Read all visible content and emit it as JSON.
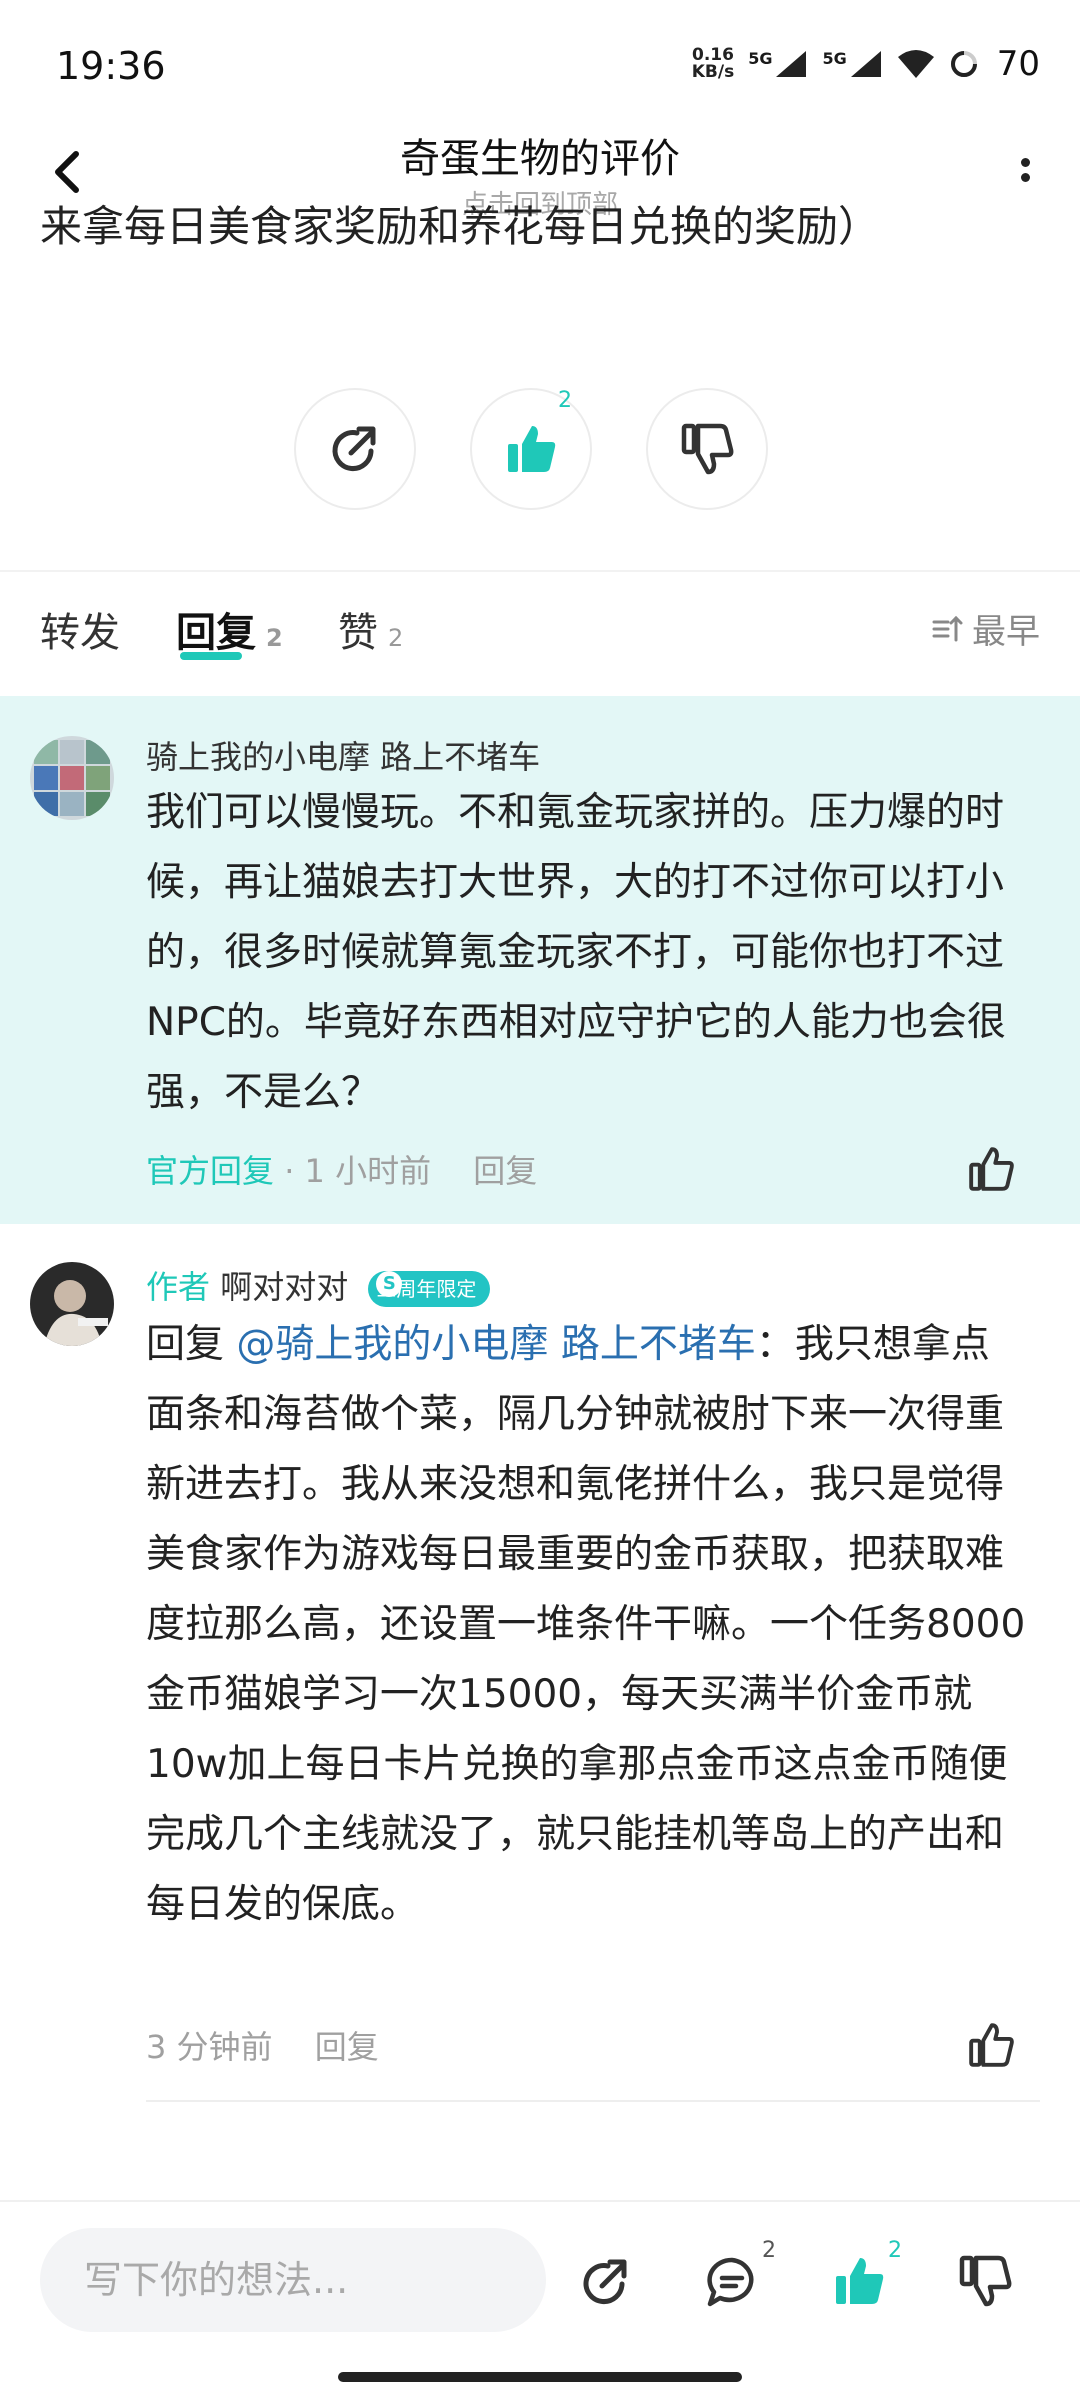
{
  "status_bar": {
    "time": "19:36",
    "net_speed_value": "0.16",
    "net_speed_unit": "KB/s",
    "signal1_label": "5G",
    "signal2_label": "5G",
    "battery": "70"
  },
  "header": {
    "title": "奇蛋生物的评价",
    "subtitle": "点击回到顶部"
  },
  "partial_text": "来拿每日美食家奖励和养花每日兑换的奖励）",
  "actions": {
    "like_count": "2"
  },
  "tabs": {
    "repost": "转发",
    "reply": "回复",
    "reply_count": "2",
    "like": "赞",
    "like_count": "2",
    "sort": "最早"
  },
  "comments": [
    {
      "username": "骑上我的小电摩 路上不堵车",
      "body": "我们可以慢慢玩。不和氪金玩家拼的。压力爆的时候，再让猫娘去打大世界，大的打不过你可以打小的，很多时候就算氪金玩家不打，可能你也打不过NPC的。毕竟好东西相对应守护它的人能力也会很强，不是么？",
      "official_label": "官方回复",
      "time": "· 1 小时前",
      "reply_label": "回复"
    },
    {
      "author_label": "作者",
      "username": "啊对对对",
      "badge": "三周年限定",
      "reply_prefix": "回复",
      "mention": "@骑上我的小电摩 路上不堵车",
      "body": "：我只想拿点面条和海苔做个菜，隔几分钟就被肘下来一次得重新进去打。我从来没想和氪佬拼什么，我只是觉得美食家作为游戏每日最重要的金币获取，把获取难度拉那么高，还设置一堆条件干嘛。一个任务8000金币猫娘学习一次15000，每天买满半价金币就10w加上每日卡片兑换的拿那点金币这点金币随便完成几个主线就没了，就只能挂机等岛上的产出和每日发的保底。",
      "time": "3 分钟前",
      "reply_label": "回复"
    }
  ],
  "bottom_bar": {
    "placeholder": "写下你的想法...",
    "comment_count": "2",
    "like_count": "2"
  },
  "colors": {
    "accent": "#1fc8b8",
    "official_bg": "#e3f7f6",
    "mention": "#2a6fb0"
  }
}
